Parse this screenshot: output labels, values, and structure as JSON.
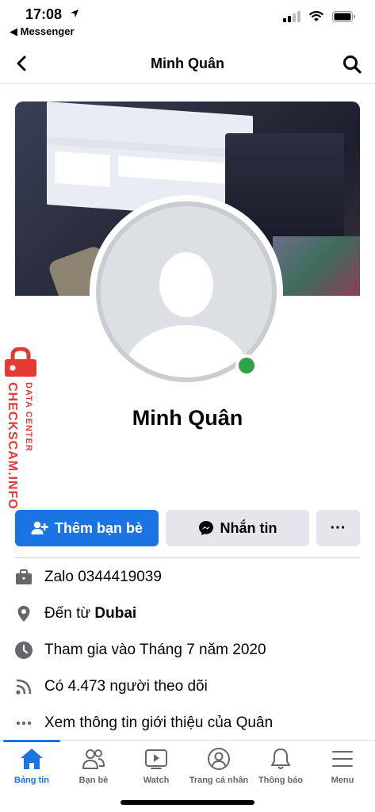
{
  "status_bar": {
    "time": "17:08",
    "back_app": "◀ Messenger"
  },
  "nav": {
    "title": "Minh Quân"
  },
  "profile": {
    "name": "Minh Quân"
  },
  "watermark": {
    "brand": "CHECKSCAM.INFO",
    "sub": "DATA CENTER"
  },
  "actions": {
    "add_friend": "Thêm bạn bè",
    "message": "Nhắn tin",
    "more": "···"
  },
  "info": {
    "zalo": "Zalo 0344419039",
    "from_prefix": "Đến từ ",
    "from_place": "Dubai",
    "joined": "Tham gia vào Tháng 7 năm 2020",
    "followers": "Có 4.473 người theo dõi",
    "see_about": "Xem thông tin giới thiệu của Quân"
  },
  "tabs": [
    {
      "label": "Bảng tin",
      "icon": "home-icon",
      "active": true
    },
    {
      "label": "Bạn bè",
      "icon": "friends-icon"
    },
    {
      "label": "Watch",
      "icon": "watch-icon"
    },
    {
      "label": "Trang cá nhân",
      "icon": "profile-icon"
    },
    {
      "label": "Thông báo",
      "icon": "bell-icon"
    },
    {
      "label": "Menu",
      "icon": "menu-icon"
    }
  ],
  "colors": {
    "accent": "#1b74e4",
    "online": "#31a24c",
    "watermark": "#e53935"
  }
}
